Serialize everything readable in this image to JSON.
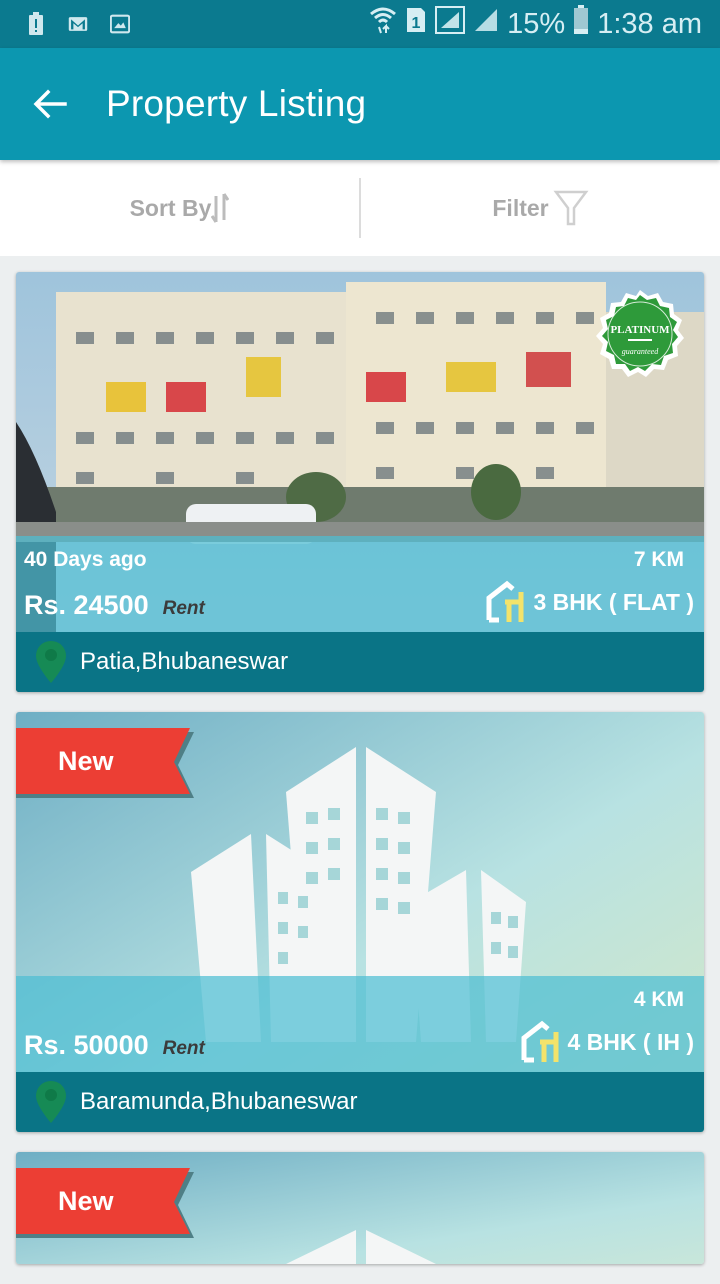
{
  "status_bar": {
    "left_icons": [
      "alert-icon",
      "gmail-icon",
      "image-icon"
    ],
    "right_icons": [
      "wifi-icon",
      "sim-1-icon",
      "signal-icon",
      "signal-icon-2"
    ],
    "battery": "15%",
    "time": "1:38 am"
  },
  "app_bar": {
    "back_icon": "arrow-left-icon",
    "title": "Property Listing",
    "color": "#0c97b0"
  },
  "toolbar": {
    "sort_label": "Sort By",
    "filter_label": "Filter"
  },
  "listings": [
    {
      "badge": "Platinum Guaranteed",
      "badge_top": "PLATINUM",
      "badge_bottom": "guaranteed",
      "posted": "40 Days ago",
      "price": "Rs. 24500",
      "type": "Rent",
      "distance": "7 KM",
      "bhk": "3 BHK ( FLAT )",
      "location": "Patia,Bhubaneswar",
      "image": "apartment-photo"
    },
    {
      "ribbon": "New",
      "posted": "",
      "price": "Rs. 50000",
      "type": "Rent",
      "distance": "4 KM",
      "bhk": "4 BHK ( IH )",
      "location": "Baramunda,Bhubaneswar",
      "image": "placeholder-buildings"
    },
    {
      "ribbon": "New",
      "image": "placeholder-buildings"
    }
  ]
}
